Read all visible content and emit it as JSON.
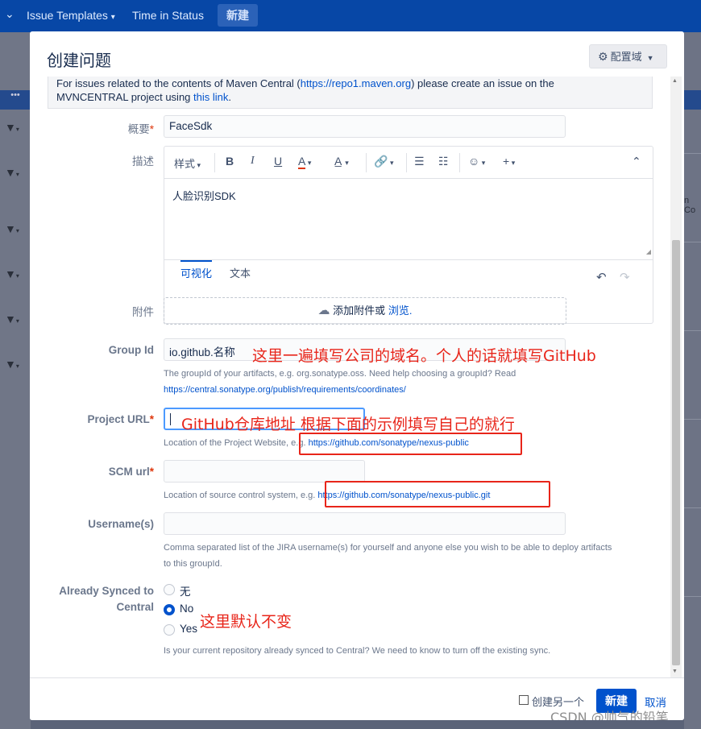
{
  "topnav": {
    "dropdown_caret": "⌄",
    "issue_templates": "Issue Templates",
    "time_in_status": "Time in Status",
    "create_button": "新建"
  },
  "background": {
    "dots": "•••",
    "right_partial_text": "n Co"
  },
  "dialog": {
    "title": "创建问题",
    "config_button": "配置域"
  },
  "notice": {
    "prefix": "For issues related to the contents of Maven Central (",
    "url": "https://repo1.maven.org",
    "middle": ") please create an issue on the",
    "line2_prefix": "MVNCENTRAL project using ",
    "link": "this link",
    "suffix": "."
  },
  "summary": {
    "label": "概要",
    "value": "FaceSdk"
  },
  "description": {
    "label": "描述",
    "toolbar": {
      "style": "样式",
      "bold": "B",
      "italic": "I",
      "underline": "U",
      "text_color": "A"
    },
    "content": "人脸识别SDK",
    "tabs": [
      "可视化",
      "文本"
    ]
  },
  "attachment": {
    "label": "附件",
    "text": "添加附件或",
    "browse": "浏览."
  },
  "group_id": {
    "label": "Group Id",
    "value": "io.github.名称",
    "help1": "The groupId of your artifacts, e.g. org.sonatype.oss. Need help choosing a groupId? Read",
    "help_link": "https://central.sonatype.org/publish/requirements/coordinates/"
  },
  "project_url": {
    "label": "Project URL",
    "value": "",
    "help_prefix": "Location of the Project Website, e.g. ",
    "help_link": "https://github.com/sonatype/nexus-public"
  },
  "scm_url": {
    "label": "SCM url",
    "value": "",
    "help_prefix": "Location of source control system, e.g. ",
    "help_link": "https://github.com/sonatype/nexus-public.git"
  },
  "usernames": {
    "label": "Username(s)",
    "value": "",
    "help1": "Comma separated list of the JIRA username(s) for yourself and anyone else you wish to be able to deploy artifacts",
    "help2": "to this groupId."
  },
  "already_synced": {
    "label_line1": "Already Synced to",
    "label_line2": "Central",
    "options": [
      "无",
      "No",
      "Yes"
    ],
    "selected": "No",
    "help": "Is your current repository already synced to Central? We need to know to turn off the existing sync."
  },
  "annotations": {
    "group_id": "这里一遍填写公司的域名。个人的话就填写GitHub",
    "project_url": "GitHub仓库地址  根据下面的示例填写自己的就行",
    "synced": "这里默认不变",
    "color": "#e8251a"
  },
  "footer": {
    "create_another": "创建另一个",
    "create": "新建",
    "cancel": "取消",
    "watermark": "CSDN @帅气的铅笔"
  },
  "colors": {
    "nav": "#0747a6",
    "primary": "#0052cc",
    "required": "#de350b"
  }
}
